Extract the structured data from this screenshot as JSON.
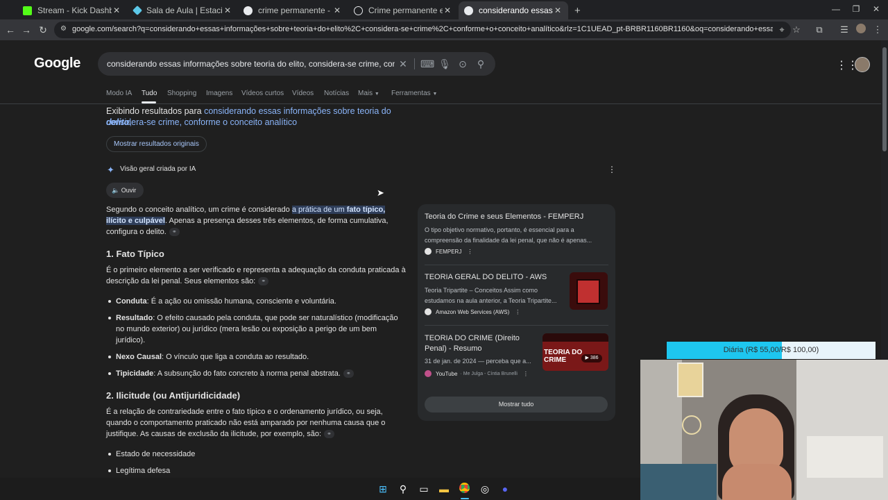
{
  "browser": {
    "tabs": [
      {
        "title": "Stream - Kick Dashboard",
        "icon": "kick-icon",
        "color": "#53fc18"
      },
      {
        "title": "Sala de Aula | Estacio",
        "icon": "estacio-icon",
        "color": "#5cc8e8"
      },
      {
        "title": "crime permanente - Pesquisa G",
        "icon": "google-icon",
        "color": "#e8eaed"
      },
      {
        "title": "Crime permanente exemplos",
        "icon": "globe-icon",
        "color": "#e8eaed"
      },
      {
        "title": "considerando essas informaçõe",
        "icon": "google-icon",
        "color": "#e8eaed"
      }
    ],
    "url": "google.com/search?q=considerando+essas+informações+sobre+teoria+do+elito%2C+considera-se+crime%2C+conforme+o+conceito+analítico&rlz=1C1UEAD_pt-BRBR1160BR1160&oq=considerando+essas+informações+sobre+teoria+do..."
  },
  "google": {
    "logo": "Google",
    "query": "considerando essas informações sobre teoria do elito, considera-se crime, conforme o conceito analítico",
    "tabs": [
      "Modo IA",
      "Tudo",
      "Shopping",
      "Imagens",
      "Vídeos curtos",
      "Vídeos",
      "Notícias",
      "Mais",
      "Ferramentas"
    ]
  },
  "correction": {
    "prefix": "Exibindo resultados para ",
    "link_a": "considerando essas informações sobre teoria do ",
    "link_b": "delito",
    "link_c": ",",
    "line2": "considera-se crime, conforme o conceito analítico",
    "show_original": "Mostrar resultados originais"
  },
  "ai_overview": {
    "header": "Visão geral criada por IA",
    "listen": "Ouvir",
    "intro_a": "Segundo o conceito analítico, um crime é considerado ",
    "intro_hl_a": "a prática de um ",
    "intro_hl_b": "fato típico,",
    "intro_hl_c": "ilícito e culpável",
    "intro_b": ". Apenas a presença desses três elementos, de forma cumulativa,",
    "intro_c": "configura o delito.",
    "s1_title": "1. Fato Típico",
    "s1_text_a": "É o primeiro elemento a ser verificado e representa a adequação da conduta praticada à",
    "s1_text_b": "descrição da lei penal. Seus elementos são:",
    "bullets": [
      {
        "term": "Conduta",
        "text": ": É a ação ou omissão humana, consciente e voluntária."
      },
      {
        "term": "Resultado",
        "text": ": O efeito causado pela conduta, que pode ser naturalístico (modificação",
        "text2": "no mundo exterior) ou jurídico (mera lesão ou exposição a perigo de um bem",
        "text3": "jurídico)."
      },
      {
        "term": "Nexo Causal",
        "text": ": O vínculo que liga a conduta ao resultado."
      },
      {
        "term": "Tipicidade",
        "text": ": A subsunção do fato concreto à norma penal abstrata."
      }
    ],
    "s2_title": "2. Ilicitude (ou Antijuridicidade)",
    "s2_text_a": "É a relação de contrariedade entre o fato típico e o ordenamento jurídico, ou seja,",
    "s2_text_b": "quando o comportamento praticado não está amparado por nenhuma causa que o",
    "s2_text_c": "justifique. As causas de exclusão da ilicitude, por exemplo, são:",
    "s2_bullets": [
      "Estado de necessidade",
      "Legítima defesa"
    ]
  },
  "references": [
    {
      "title": "Teoria do Crime e seus Elementos - FEMPERJ",
      "snippet_a": "O tipo objetivo normativo, portanto, é essencial para a",
      "snippet_b": "compreensão da finalidade da lei penal, que não é apenas...",
      "source": "FEMPERJ"
    },
    {
      "title": "TEORIA GERAL DO DELITO - AWS",
      "snippet_a": "Teoria Tripartite – Conceitos Assim como",
      "snippet_b": "estudamos na aula anterior, a Teoria Tripartite...",
      "source": "Amazon Web Services (AWS)"
    },
    {
      "title_a": "TEORIA DO CRIME (Direito",
      "title_b": "Penal) - Resumo",
      "snippet_a": "31 de jan. de 2024 — perceba que a...",
      "source": "YouTube",
      "source_sub": "· Me Julga - Cíntia Brunelli",
      "thumb_text": "TEORIA DO CRIME",
      "thumb_badge": "386"
    }
  ],
  "show_all": "Mostrar tudo",
  "overlay": {
    "label": "Diária (R$ 55,00/R$ 100,00)",
    "progress": 0.55,
    "fill_color": "#1ec6ef"
  },
  "taskbar": {
    "items": [
      "windows-start-icon",
      "search-icon",
      "task-view-icon",
      "file-explorer-icon",
      "chrome-icon",
      "obs-icon",
      "discord-icon"
    ]
  }
}
